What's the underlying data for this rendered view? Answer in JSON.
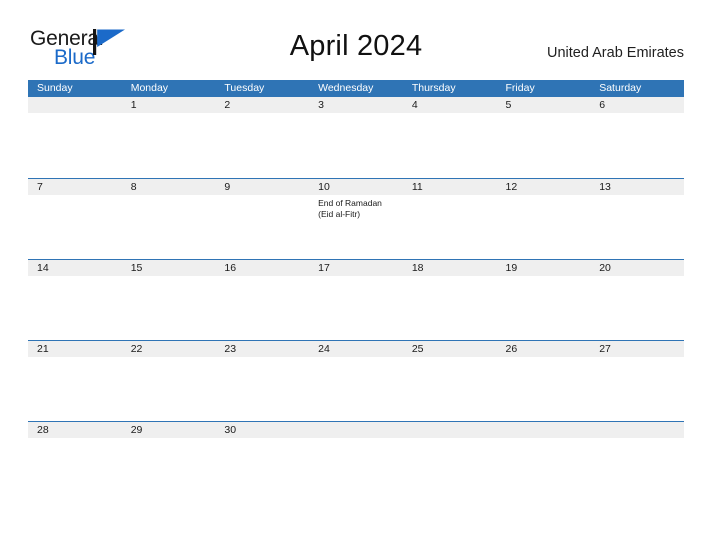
{
  "brand": {
    "name_part1": "General",
    "name_part2": "Blue",
    "flag_icon": "flag-icon",
    "color_text": "#1a1a1a",
    "color_blue": "#1b6ac9"
  },
  "header": {
    "title": "April 2024",
    "region": "United Arab Emirates"
  },
  "theme": {
    "header_blue": "#2f74b5",
    "band_gray": "#efefef",
    "rule_blue": "#2f74b5"
  },
  "calendar": {
    "month": "April",
    "year": "2024",
    "weekday_headers": [
      "Sunday",
      "Monday",
      "Tuesday",
      "Wednesday",
      "Thursday",
      "Friday",
      "Saturday"
    ],
    "weeks": [
      {
        "days": [
          {
            "num": "",
            "events": []
          },
          {
            "num": "1",
            "events": []
          },
          {
            "num": "2",
            "events": []
          },
          {
            "num": "3",
            "events": []
          },
          {
            "num": "4",
            "events": []
          },
          {
            "num": "5",
            "events": []
          },
          {
            "num": "6",
            "events": []
          }
        ]
      },
      {
        "days": [
          {
            "num": "7",
            "events": []
          },
          {
            "num": "8",
            "events": []
          },
          {
            "num": "9",
            "events": []
          },
          {
            "num": "10",
            "events": [
              "End of Ramadan",
              "(Eid al-Fitr)"
            ]
          },
          {
            "num": "11",
            "events": []
          },
          {
            "num": "12",
            "events": []
          },
          {
            "num": "13",
            "events": []
          }
        ]
      },
      {
        "days": [
          {
            "num": "14",
            "events": []
          },
          {
            "num": "15",
            "events": []
          },
          {
            "num": "16",
            "events": []
          },
          {
            "num": "17",
            "events": []
          },
          {
            "num": "18",
            "events": []
          },
          {
            "num": "19",
            "events": []
          },
          {
            "num": "20",
            "events": []
          }
        ]
      },
      {
        "days": [
          {
            "num": "21",
            "events": []
          },
          {
            "num": "22",
            "events": []
          },
          {
            "num": "23",
            "events": []
          },
          {
            "num": "24",
            "events": []
          },
          {
            "num": "25",
            "events": []
          },
          {
            "num": "26",
            "events": []
          },
          {
            "num": "27",
            "events": []
          }
        ]
      },
      {
        "days": [
          {
            "num": "28",
            "events": []
          },
          {
            "num": "29",
            "events": []
          },
          {
            "num": "30",
            "events": []
          },
          {
            "num": "",
            "events": []
          },
          {
            "num": "",
            "events": []
          },
          {
            "num": "",
            "events": []
          },
          {
            "num": "",
            "events": []
          }
        ]
      }
    ]
  }
}
